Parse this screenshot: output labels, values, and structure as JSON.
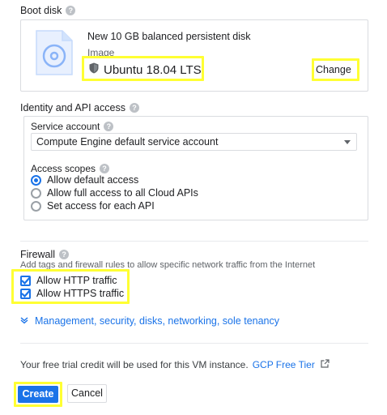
{
  "boot_disk": {
    "title": "Boot disk",
    "disk_description": "New 10 GB balanced persistent disk",
    "image_label": "Image",
    "image_name": "Ubuntu 18.04 LTS",
    "change_label": "Change"
  },
  "identity": {
    "title": "Identity and API access",
    "service_account_label": "Service account",
    "service_account_value": "Compute Engine default service account",
    "access_scopes_label": "Access scopes",
    "scopes": [
      {
        "label": "Allow default access",
        "selected": true
      },
      {
        "label": "Allow full access to all Cloud APIs",
        "selected": false
      },
      {
        "label": "Set access for each API",
        "selected": false
      }
    ]
  },
  "firewall": {
    "title": "Firewall",
    "description": "Add tags and firewall rules to allow specific network traffic from the Internet",
    "options": [
      {
        "label": "Allow HTTP traffic",
        "checked": true
      },
      {
        "label": "Allow HTTPS traffic",
        "checked": true
      }
    ]
  },
  "management_link": "Management, security, disks, networking, sole tenancy",
  "trial": {
    "text": "Your free trial credit will be used for this VM instance.",
    "link": "GCP Free Tier"
  },
  "actions": {
    "create_label": "Create",
    "cancel_label": "Cancel"
  },
  "colors": {
    "accent": "#1a73e8",
    "highlight": "#ffff33"
  }
}
